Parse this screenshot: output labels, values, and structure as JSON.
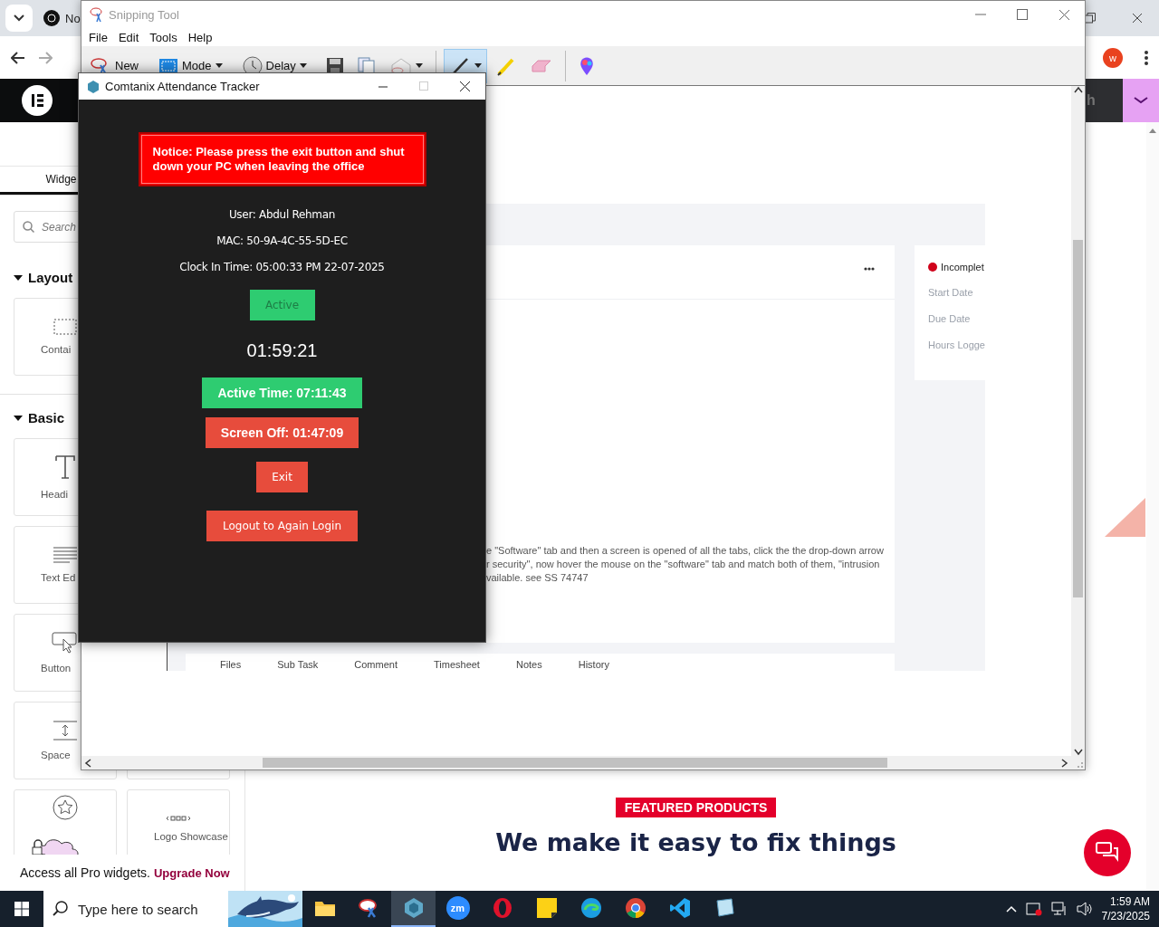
{
  "browser": {
    "tab": {
      "title": "No"
    },
    "profile": {
      "initial": "w"
    },
    "editor_bar": {
      "text": "h"
    },
    "panel": {
      "tab": "Widge",
      "search": {
        "placeholder": "Search"
      },
      "sections": [
        {
          "title": "Layout",
          "expanded": true,
          "columns": [
            [
              {
                "kind": "container",
                "label": "Contai"
              }
            ]
          ]
        },
        {
          "title": "Basic",
          "expanded": true,
          "columns": [
            [
              {
                "kind": "heading",
                "label": "Headi"
              },
              {
                "kind": "text-editor",
                "label": "Text Ed"
              },
              {
                "kind": "button",
                "label": "Button"
              },
              {
                "kind": "spacer",
                "label": "Space"
              },
              {
                "kind": "star"
              }
            ],
            [
              {
                "kind": "blank"
              },
              {
                "kind": "logo-showcase",
                "label": "Logo Showcase"
              }
            ]
          ]
        }
      ],
      "promo": {
        "text": "Access all Pro widgets.",
        "link": "Upgrade Now"
      }
    },
    "page": {
      "badge": "FEATURED PRODUCTS",
      "heading": "We make it easy to fix things"
    }
  },
  "snipping_tool": {
    "title": "Snipping Tool",
    "menu": [
      "File",
      "Edit",
      "Tools",
      "Help"
    ],
    "toolbar": [
      {
        "kind": "scissors",
        "label": "New",
        "menu": false,
        "selected": false
      },
      {
        "kind": "mode",
        "label": "Mode",
        "menu": true,
        "selected": false
      },
      {
        "kind": "clock",
        "label": "Delay",
        "menu": true,
        "selected": false
      },
      {
        "kind": "save",
        "menu": false,
        "selected": false
      },
      {
        "kind": "copy",
        "menu": false,
        "selected": false
      },
      {
        "kind": "send",
        "menu": true,
        "selected": false
      },
      {
        "kind": "separator"
      },
      {
        "kind": "pen",
        "menu": true,
        "selected": true
      },
      {
        "kind": "highlighter",
        "menu": false,
        "selected": false
      },
      {
        "kind": "eraser",
        "menu": false,
        "selected": false
      },
      {
        "kind": "separator"
      },
      {
        "kind": "paint",
        "menu": false,
        "selected": false
      }
    ],
    "capture": {
      "status": "Incomplet",
      "fields": [
        "Start Date",
        "Due Date",
        "Hours Logge"
      ],
      "description": [
        "e \"Software\" tab and then a screen is opened of all the tabs, click the the drop-down arrow",
        "r security\", now hover the mouse on the \"software\" tab and match both of them, \"intrusion",
        "vailable. see SS 74747"
      ],
      "tabs": [
        "Files",
        "Sub Task",
        "Comment",
        "Timesheet",
        "Notes",
        "History"
      ]
    }
  },
  "tracker": {
    "title": "Comtanix Attendance Tracker",
    "window_controls": [
      {
        "kind": "minimize",
        "disabled": false
      },
      {
        "kind": "maximize",
        "disabled": true
      },
      {
        "kind": "close",
        "disabled": false
      }
    ],
    "notice": "Notice: Please press the exit button and shut down your PC when leaving the office",
    "info": [
      "User: Abdul Rehman",
      "MAC: 50-9A-4C-55-5D-EC",
      "Clock In Time: 05:00:33 PM 22-07-2025"
    ],
    "status": {
      "label": "Active",
      "active": true
    },
    "timer": "01:59:21",
    "counters": [
      {
        "label": "Active Time: 07:11:43",
        "color": "#2ecc71"
      },
      {
        "label": "Screen Off: 01:47:09",
        "color": "#e74c3c"
      }
    ],
    "buttons": [
      "Exit",
      "Logout to Again Login"
    ]
  },
  "taskbar": {
    "search_placeholder": "Type here to search",
    "apps": [
      {
        "kind": "folder",
        "selected": false
      },
      {
        "kind": "snipping",
        "selected": false
      },
      {
        "kind": "tracker",
        "selected": true
      },
      {
        "kind": "zoom",
        "label": "zm",
        "selected": false
      },
      {
        "kind": "opera",
        "selected": false
      },
      {
        "kind": "sticky-notes",
        "selected": false
      },
      {
        "kind": "edge",
        "selected": false
      },
      {
        "kind": "chrome",
        "selected": false
      },
      {
        "kind": "vscode",
        "selected": false
      },
      {
        "kind": "notepad",
        "selected": false
      }
    ],
    "tray": {
      "time": "1:59 AM",
      "date": "7/23/2025"
    }
  }
}
